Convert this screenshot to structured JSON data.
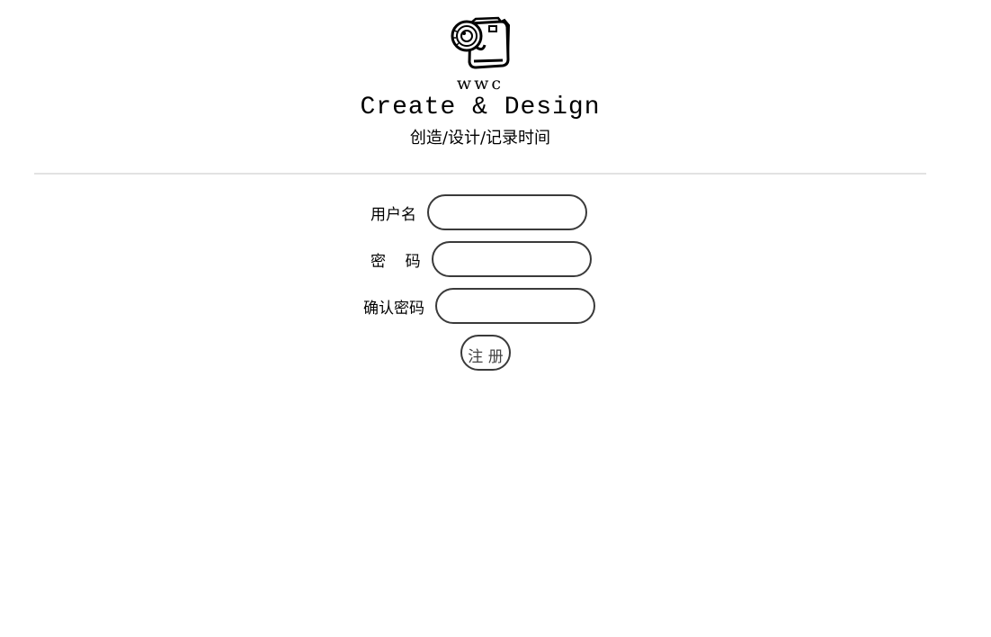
{
  "header": {
    "logo_icon": "camera-icon",
    "brand": "wwc",
    "tagline": "Create & Design",
    "subtitle": "创造/设计/记录时间"
  },
  "form": {
    "username_label": "用户名",
    "username_value": "",
    "password_label": "密    码",
    "password_value": "",
    "confirm_label": "确认密码",
    "confirm_value": "",
    "submit_label": "注 册"
  },
  "colors": {
    "input_border": "#3a3a3a",
    "divider": "#e2e2e2",
    "button_text": "#444444"
  }
}
